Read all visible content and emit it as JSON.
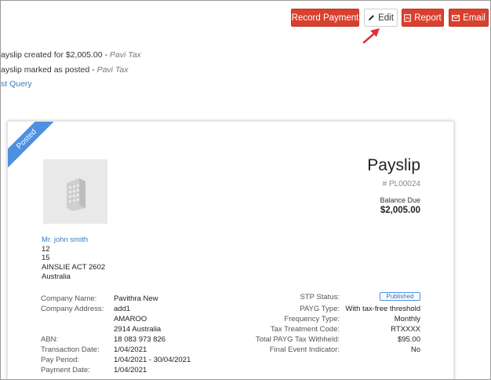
{
  "toolbar": {
    "record_payment": "Record Payment",
    "edit": "Edit",
    "report": "Report",
    "email": "Email"
  },
  "activity": {
    "rows": [
      {
        "text": "ayslip created for $2,005.00 - ",
        "author": "Pavi Tax"
      },
      {
        "text": "ayslip marked as posted - ",
        "author": "Pavi Tax"
      }
    ],
    "link": "st Query"
  },
  "payslip": {
    "ribbon": "Posted",
    "title": "Payslip",
    "number": "# PL00024",
    "balance_label": "Balance Due",
    "balance_value": "$2,005.00",
    "employee": {
      "name": "Mr. john smith",
      "line1": "12",
      "line2": "15",
      "line3": "AINSLIE ACT 2602",
      "line4": "Australia"
    },
    "left": {
      "company_name_label": "Company Name:",
      "company_name": "Pavithra New",
      "company_address_label": "Company Address:",
      "address1": "add1",
      "address2": "AMAROO",
      "address3": "2914 Australia",
      "abn_label": "ABN:",
      "abn": "18 083 973 826",
      "transaction_date_label": "Transaction Date:",
      "transaction_date": "1/04/2021",
      "pay_period_label": "Pay Period:",
      "pay_period": "1/04/2021 - 30/04/2021",
      "payment_date_label": "Payment Date:",
      "payment_date": "1/04/2021"
    },
    "right": {
      "stp_status_label": "STP Status:",
      "stp_status": "Published",
      "payg_type_label": "PAYG Type:",
      "payg_type": "With tax-free threshold",
      "frequency_label": "Frequency Type:",
      "frequency": "Monthly",
      "tax_code_label": "Tax Treatment Code:",
      "tax_code": "RTXXXX",
      "payg_withheld_label": "Total PAYG Tax Withheld:",
      "payg_withheld": "$95.00",
      "final_event_label": "Final Event Indicator:",
      "final_event": "No"
    }
  },
  "colors": {
    "primary_red": "#d9402e",
    "ribbon_blue": "#4d90e0",
    "link_blue": "#3a7abf",
    "annotation_arrow": "#e0313a"
  },
  "icons": [
    "pencil-icon",
    "pdf-file-icon",
    "envelope-icon",
    "building-icon",
    "annotation-arrow"
  ]
}
